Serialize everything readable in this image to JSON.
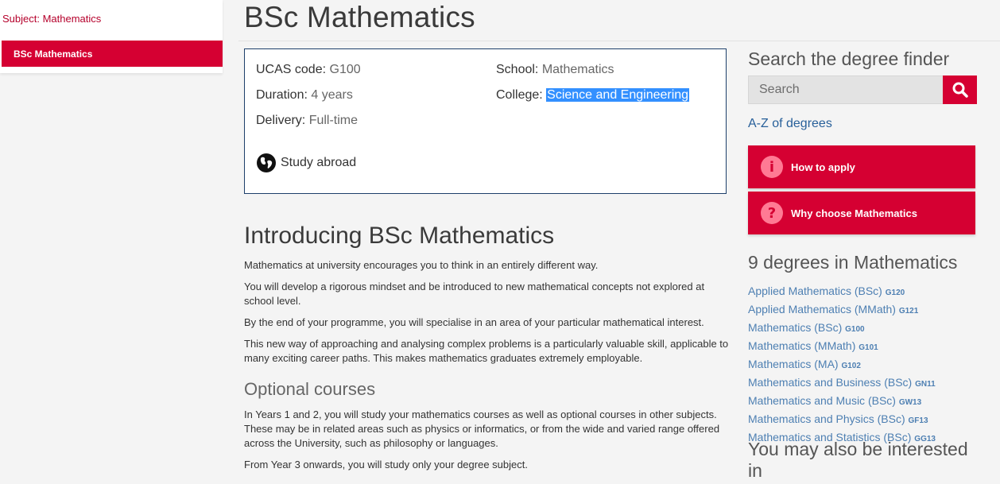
{
  "sidebar": {
    "subject_label": "Subject: Mathematics",
    "active_item": "BSc Mathematics"
  },
  "page": {
    "title": "BSc Mathematics"
  },
  "info": {
    "ucas_label": "UCAS code:",
    "ucas_value": "G100",
    "duration_label": "Duration:",
    "duration_value": "4 years",
    "delivery_label": "Delivery:",
    "delivery_value": "Full-time",
    "school_label": "School:",
    "school_value": "Mathematics",
    "college_label": "College:",
    "college_value": "Science and Engineering",
    "study_abroad": "Study abroad",
    "study_abroad_icon": "globe-icon"
  },
  "intro": {
    "heading": "Introducing BSc Mathematics",
    "paragraphs": [
      "Mathematics at university encourages you to think in an entirely different way.",
      "You will develop a rigorous mindset and be introduced to new mathematical concepts not explored at school level.",
      "By the end of your programme, you will specialise in an area of your particular mathematical interest.",
      "This new way of approaching and analysing complex problems is a particularly valuable skill, applicable to many exciting career paths. This makes mathematics graduates extremely employable."
    ]
  },
  "optional": {
    "heading": "Optional courses",
    "paragraphs": [
      "In Years 1 and 2, you will study your mathematics courses as well as optional courses in other subjects. These may be in related areas such as physics or informatics, or from the wide and varied range offered across the University, such as philosophy or languages.",
      "From Year 3 onwards, you will study only your degree subject."
    ]
  },
  "search": {
    "heading": "Search the degree finder",
    "placeholder": "Search",
    "button_icon": "search-icon",
    "az_link": "A-Z of degrees"
  },
  "actions": [
    {
      "label": "How to apply",
      "icon": "info-icon",
      "glyph": "i"
    },
    {
      "label": "Why choose Mathematics",
      "icon": "question-icon",
      "glyph": "?"
    }
  ],
  "degrees": {
    "heading": "9 degrees in Mathematics",
    "items": [
      {
        "name": "Applied Mathematics (BSc)",
        "code": "G120"
      },
      {
        "name": "Applied Mathematics (MMath)",
        "code": "G121"
      },
      {
        "name": "Mathematics (BSc)",
        "code": "G100"
      },
      {
        "name": "Mathematics (MMath)",
        "code": "G101"
      },
      {
        "name": "Mathematics (MA)",
        "code": "G102"
      },
      {
        "name": "Mathematics and Business (BSc)",
        "code": "GN11"
      },
      {
        "name": "Mathematics and Music (BSc)",
        "code": "GW13"
      },
      {
        "name": "Mathematics and Physics (BSc)",
        "code": "GF13"
      },
      {
        "name": "Mathematics and Statistics (BSc)",
        "code": "GG13"
      }
    ]
  },
  "also": {
    "heading": "You may also be interested in"
  },
  "colors": {
    "brand_red": "#d50032",
    "link_blue": "#4d7fb2",
    "box_border": "#1d3f6a",
    "selection": "#3390ff"
  }
}
